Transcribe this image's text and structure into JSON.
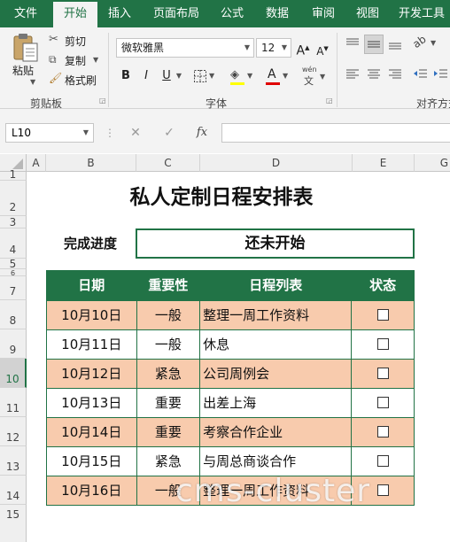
{
  "ribbon": {
    "tabs": [
      "文件",
      "开始",
      "插入",
      "页面布局",
      "公式",
      "数据",
      "审阅",
      "视图",
      "开发工具"
    ],
    "active_tab": "开始",
    "clipboard": {
      "paste": "粘贴",
      "cut": "剪切",
      "copy": "复制",
      "format_painter": "格式刷",
      "label": "剪贴板"
    },
    "font": {
      "name": "微软雅黑",
      "size": "12",
      "bold": "B",
      "italic": "I",
      "underline": "U",
      "grow": "A",
      "shrink": "A",
      "font_color": "A",
      "phonetic": "wén",
      "label": "字体"
    },
    "alignment": {
      "label": "对齐方式"
    },
    "accent_color": "#217346"
  },
  "formula_bar": {
    "name_box": "L10",
    "fx": "fx",
    "value": ""
  },
  "columns": [
    "A",
    "B",
    "C",
    "D",
    "E",
    "G"
  ],
  "rows": [
    "1",
    "2",
    "3",
    "4",
    "5",
    "6",
    "7",
    "8",
    "9",
    "10",
    "11",
    "12",
    "13",
    "14",
    "15"
  ],
  "selected_row": "10",
  "sheet": {
    "title": "私人定制日程安排表",
    "progress_label": "完成进度",
    "progress_value": "还未开始",
    "headers": [
      "日期",
      "重要性",
      "日程列表",
      "状态"
    ],
    "rows": [
      {
        "date": "10月10日",
        "priority": "一般",
        "task": "整理一周工作资料"
      },
      {
        "date": "10月11日",
        "priority": "一般",
        "task": "休息"
      },
      {
        "date": "10月12日",
        "priority": "紧急",
        "task": "公司周例会"
      },
      {
        "date": "10月13日",
        "priority": "重要",
        "task": "出差上海"
      },
      {
        "date": "10月14日",
        "priority": "重要",
        "task": "考察合作企业"
      },
      {
        "date": "10月15日",
        "priority": "紧急",
        "task": "与周总商谈合作"
      },
      {
        "date": "10月16日",
        "priority": "一般",
        "task": "整理一周工作资料"
      }
    ],
    "row_fill_color": "#f8cbad"
  },
  "watermark": "cms-cluster"
}
